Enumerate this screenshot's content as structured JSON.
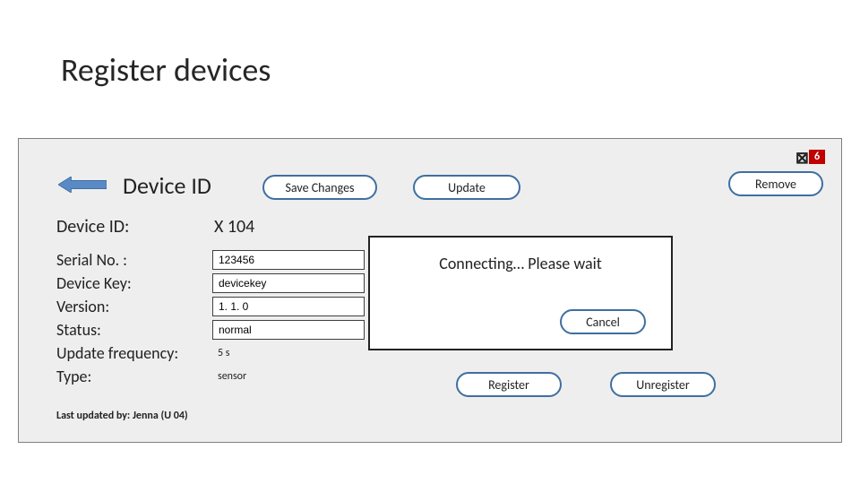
{
  "slide": {
    "title": "Register devices"
  },
  "panel": {
    "section_title": "Device ID",
    "buttons": {
      "save": "Save Changes",
      "update": "Update",
      "remove": "Remove",
      "register": "Register",
      "unregister": "Unregister"
    },
    "notification_count": "6",
    "device_id_label": "Device ID:",
    "device_id_value": "X 104",
    "fields": {
      "serial_label": "Serial No. :",
      "serial_value": "123456",
      "key_label": "Device Key:",
      "key_value": "devicekey",
      "version_label": "Version:",
      "version_value": "1. 1. 0",
      "status_label": "Status:",
      "status_value": "normal",
      "freq_label": "Update frequency:",
      "freq_value": "5 s",
      "type_label": "Type:",
      "type_value": "sensor"
    },
    "last_updated": "Last updated by: Jenna (U 04)"
  },
  "modal": {
    "message": "Connecting… Please wait",
    "cancel": "Cancel"
  }
}
